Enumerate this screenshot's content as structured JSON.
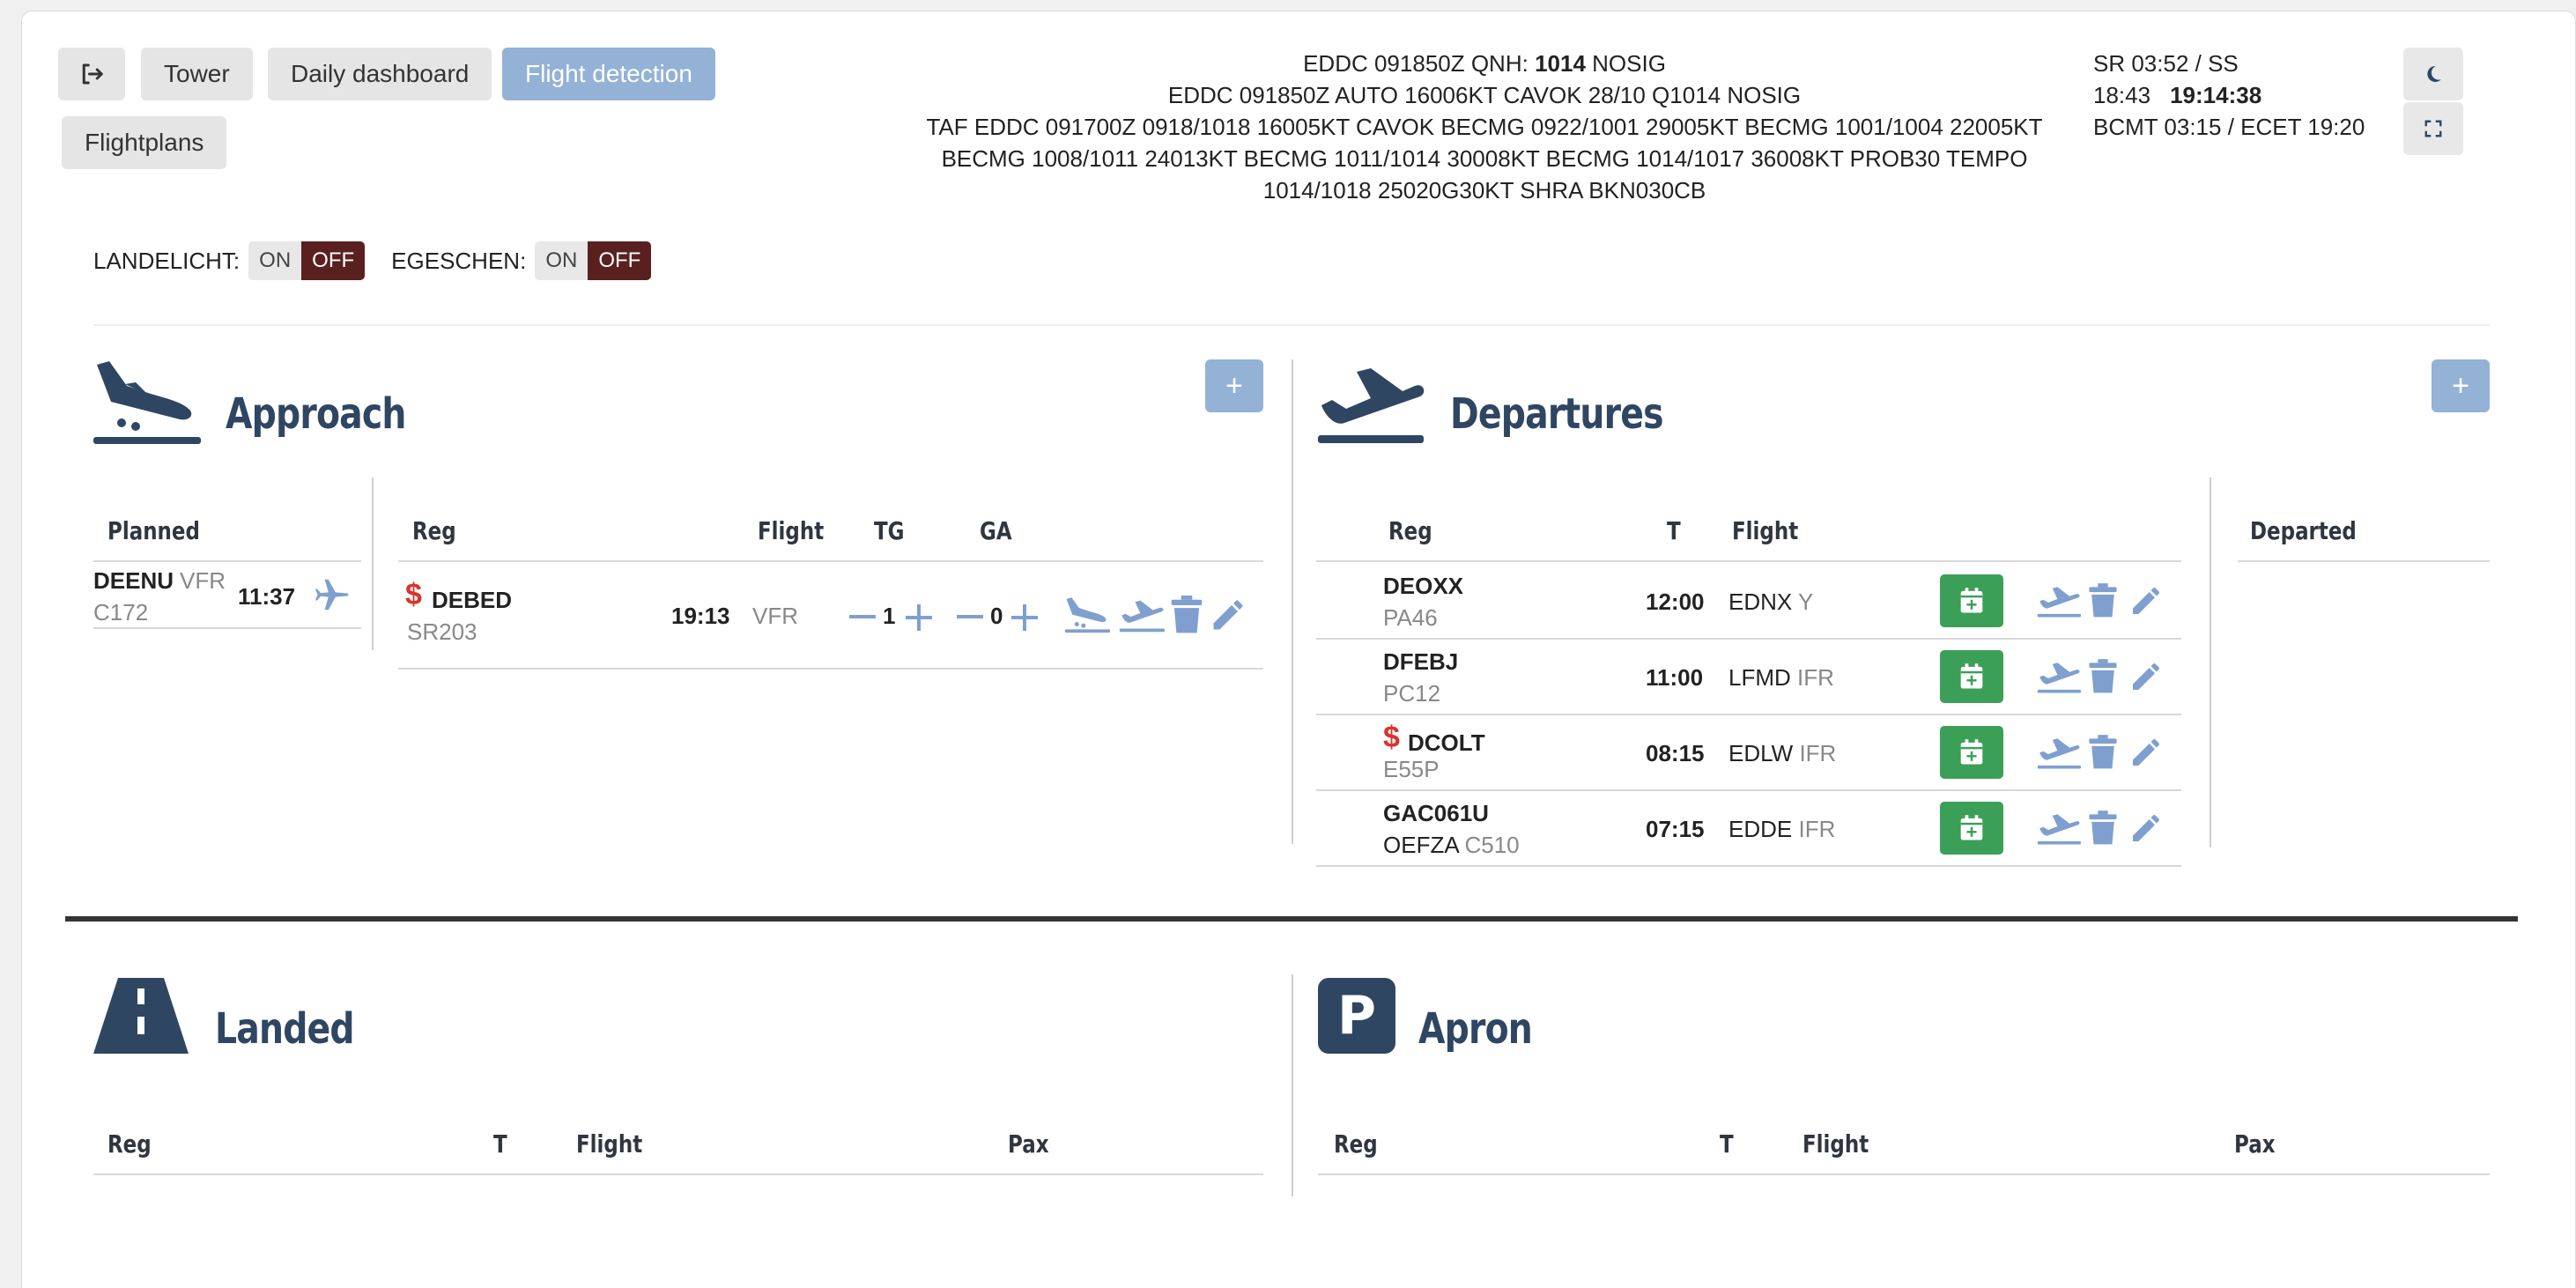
{
  "nav": {
    "tower": "Tower",
    "daily": "Daily dashboard",
    "flight_detection": "Flight detection",
    "flightplans": "Flightplans"
  },
  "weather": {
    "metar1_a": "EDDC 091850Z QNH: ",
    "metar1_qnh": "1014",
    "metar1_b": " NOSIG",
    "metar2": "EDDC 091850Z AUTO 16006KT CAVOK 28/10 Q1014 NOSIG",
    "taf1": "TAF EDDC 091700Z 0918/1018 16005KT CAVOK BECMG 0922/1001 29005KT BECMG 1001/1004 22005KT",
    "taf2": "BECMG 1008/1011 24013KT BECMG 1011/1014 30008KT BECMG 1014/1017 36008KT PROB30 TEMPO",
    "taf3": "1014/1018 25020G30KT SHRA BKN030CB"
  },
  "sun": {
    "sr": "SR 03:52 / SS",
    "ss": "18:43",
    "utc": "19:14:38",
    "bcmt": "BCMT 03:15 / ECET 19:20"
  },
  "toggles": {
    "landelicht": "LANDELICHT:",
    "egeschen": "EGESCHEN:",
    "on": "ON",
    "off": "OFF"
  },
  "approach": {
    "title": "Approach",
    "plus": "+",
    "planned_header": "Planned",
    "planned": {
      "reg": "DEENU",
      "rules": "VFR",
      "type": "C172",
      "time": "11:37"
    },
    "headers": {
      "reg": "Reg",
      "flight": "Flight",
      "tg": "TG",
      "ga": "GA"
    },
    "row": {
      "reg": "DEBED",
      "type": "SR203",
      "time": "19:13",
      "rules": "VFR",
      "tg": "1",
      "ga": "0"
    }
  },
  "departures": {
    "title": "Departures",
    "plus": "+",
    "headers": {
      "reg": "Reg",
      "t": "T",
      "flight": "Flight"
    },
    "departed_header": "Departed",
    "rows": [
      {
        "reg": "DEOXX",
        "sub": "PA46",
        "sub2": "",
        "time": "12:00",
        "dest": "EDNX",
        "rules": "Y",
        "fee": false
      },
      {
        "reg": "DFEBJ",
        "sub": "PC12",
        "sub2": "",
        "time": "11:00",
        "dest": "LFMD",
        "rules": "IFR",
        "fee": false
      },
      {
        "reg": "DCOLT",
        "sub": "E55P",
        "sub2": "",
        "time": "08:15",
        "dest": "EDLW",
        "rules": "IFR",
        "fee": true
      },
      {
        "reg": "GAC061U",
        "sub": "OEFZA",
        "sub2": "C510",
        "time": "07:15",
        "dest": "EDDE",
        "rules": "IFR",
        "fee": false
      }
    ]
  },
  "landed": {
    "title": "Landed",
    "headers": {
      "reg": "Reg",
      "t": "T",
      "flight": "Flight",
      "pax": "Pax"
    }
  },
  "apron": {
    "title": "Apron",
    "icon_letter": "P",
    "headers": {
      "reg": "Reg",
      "t": "T",
      "flight": "Flight",
      "pax": "Pax"
    }
  },
  "dollar": "$",
  "colors": {
    "accent": "#93b2d6",
    "title": "#2f4663",
    "icon": "#7f9fcf",
    "fee": "#d9342b",
    "ok": "#3b9f58",
    "off": "#5a2020"
  }
}
